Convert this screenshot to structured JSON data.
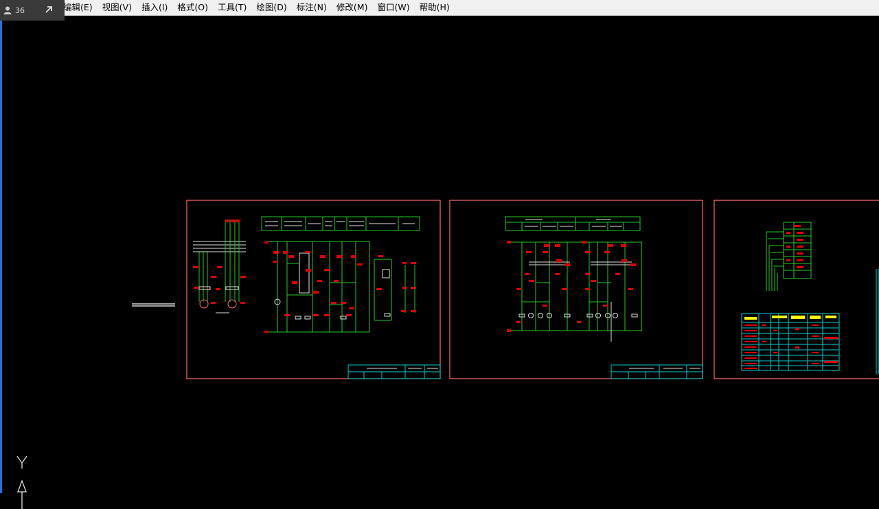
{
  "app": {
    "badge_count": "36",
    "icons": {
      "badge": "person-icon",
      "popout": "arrow-up-right-icon",
      "ucs": "ucs-axis-icon"
    }
  },
  "menu": {
    "items": [
      "编辑(E)",
      "视图(V)",
      "插入(I)",
      "格式(O)",
      "工具(T)",
      "绘图(D)",
      "标注(N)",
      "修改(M)",
      "窗口(W)",
      "帮助(H)"
    ]
  },
  "canvas": {
    "background": "#000000",
    "colors": {
      "frame": "#ff6b6b",
      "wire": "#22cc22",
      "label": "#e00000",
      "titleblock": "#00cccc",
      "yellow": "#ffff00",
      "white": "#ffffff"
    },
    "ucs_label": "Y",
    "sheets": [
      {
        "name": "sheet-1",
        "content": "motor control primary and secondary circuit"
      },
      {
        "name": "sheet-2",
        "content": "control circuit diagram"
      },
      {
        "name": "sheet-3",
        "content": "terminal and equipment table"
      }
    ]
  }
}
